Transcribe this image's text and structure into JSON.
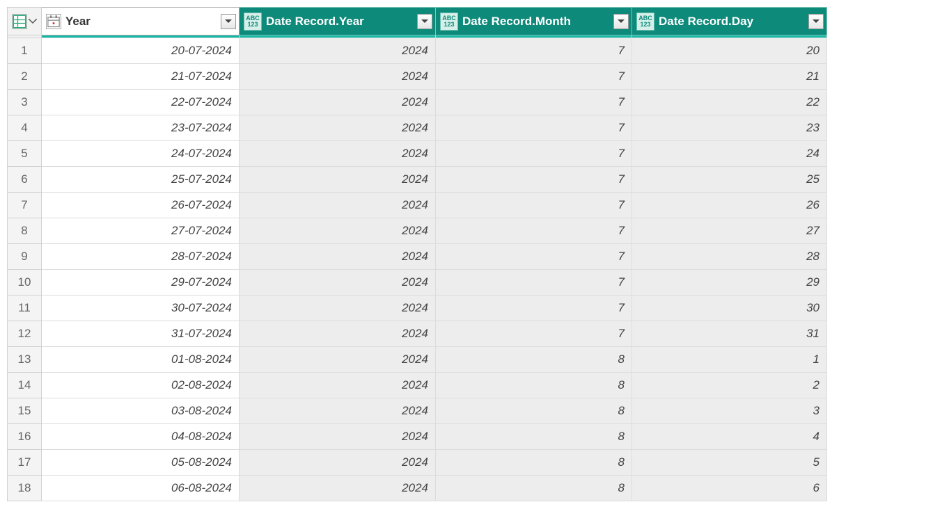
{
  "columns": {
    "rownum_icon": "table-icon",
    "col1": {
      "type_icon": "date-icon",
      "label": "Year"
    },
    "col2": {
      "type_top": "ABC",
      "type_bot": "123",
      "label": "Date Record.Year"
    },
    "col3": {
      "type_top": "ABC",
      "type_bot": "123",
      "label": "Date Record.Month"
    },
    "col4": {
      "type_top": "ABC",
      "type_bot": "123",
      "label": "Date Record.Day"
    }
  },
  "rows": [
    {
      "n": "1",
      "year": "20-07-2024",
      "ry": "2024",
      "rm": "7",
      "rd": "20"
    },
    {
      "n": "2",
      "year": "21-07-2024",
      "ry": "2024",
      "rm": "7",
      "rd": "21"
    },
    {
      "n": "3",
      "year": "22-07-2024",
      "ry": "2024",
      "rm": "7",
      "rd": "22"
    },
    {
      "n": "4",
      "year": "23-07-2024",
      "ry": "2024",
      "rm": "7",
      "rd": "23"
    },
    {
      "n": "5",
      "year": "24-07-2024",
      "ry": "2024",
      "rm": "7",
      "rd": "24"
    },
    {
      "n": "6",
      "year": "25-07-2024",
      "ry": "2024",
      "rm": "7",
      "rd": "25"
    },
    {
      "n": "7",
      "year": "26-07-2024",
      "ry": "2024",
      "rm": "7",
      "rd": "26"
    },
    {
      "n": "8",
      "year": "27-07-2024",
      "ry": "2024",
      "rm": "7",
      "rd": "27"
    },
    {
      "n": "9",
      "year": "28-07-2024",
      "ry": "2024",
      "rm": "7",
      "rd": "28"
    },
    {
      "n": "10",
      "year": "29-07-2024",
      "ry": "2024",
      "rm": "7",
      "rd": "29"
    },
    {
      "n": "11",
      "year": "30-07-2024",
      "ry": "2024",
      "rm": "7",
      "rd": "30"
    },
    {
      "n": "12",
      "year": "31-07-2024",
      "ry": "2024",
      "rm": "7",
      "rd": "31"
    },
    {
      "n": "13",
      "year": "01-08-2024",
      "ry": "2024",
      "rm": "8",
      "rd": "1"
    },
    {
      "n": "14",
      "year": "02-08-2024",
      "ry": "2024",
      "rm": "8",
      "rd": "2"
    },
    {
      "n": "15",
      "year": "03-08-2024",
      "ry": "2024",
      "rm": "8",
      "rd": "3"
    },
    {
      "n": "16",
      "year": "04-08-2024",
      "ry": "2024",
      "rm": "8",
      "rd": "4"
    },
    {
      "n": "17",
      "year": "05-08-2024",
      "ry": "2024",
      "rm": "8",
      "rd": "5"
    },
    {
      "n": "18",
      "year": "06-08-2024",
      "ry": "2024",
      "rm": "8",
      "rd": "6"
    }
  ]
}
